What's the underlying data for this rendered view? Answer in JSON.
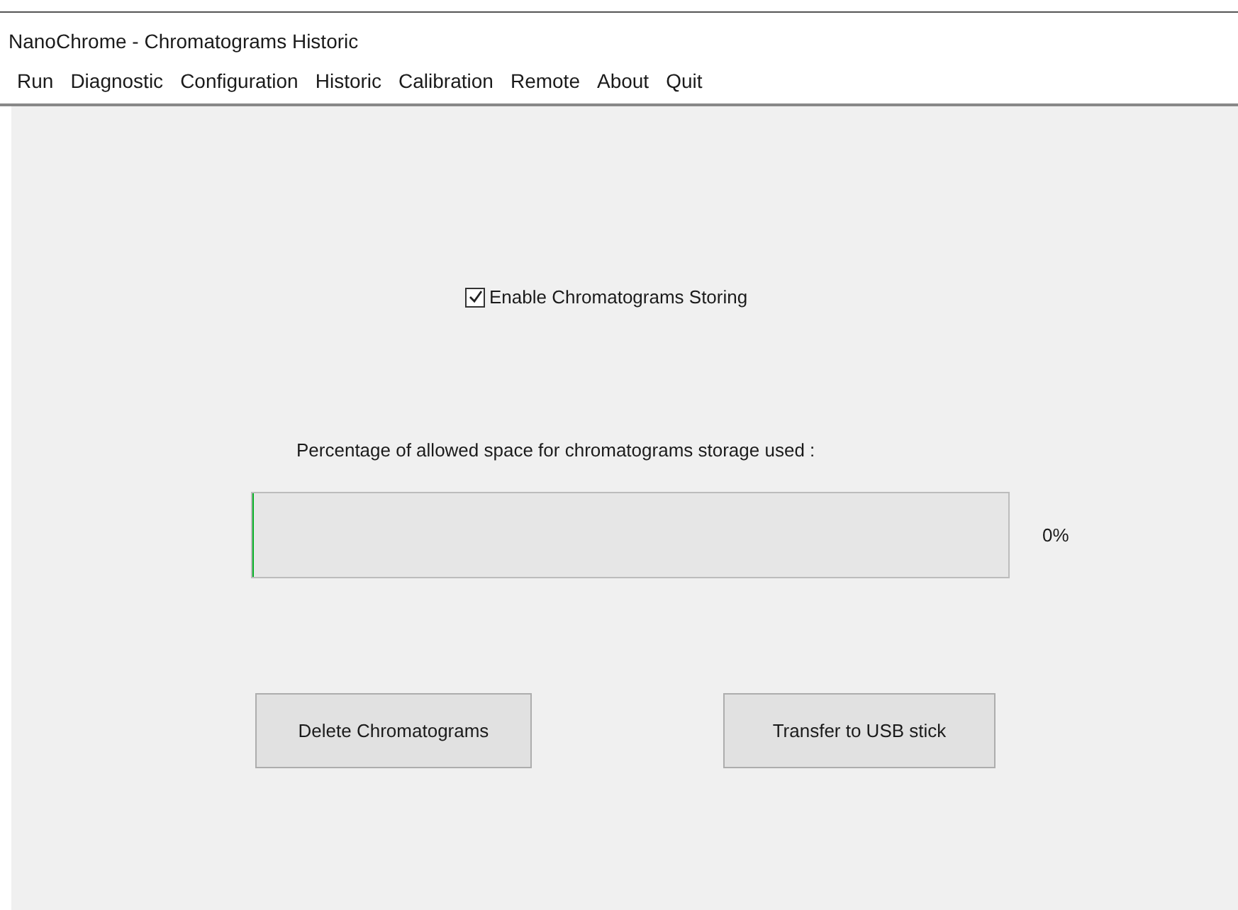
{
  "window": {
    "title": "NanoChrome - Chromatograms Historic"
  },
  "menu": [
    {
      "label": "Run"
    },
    {
      "label": "Diagnostic"
    },
    {
      "label": "Configuration"
    },
    {
      "label": "Historic"
    },
    {
      "label": "Calibration"
    },
    {
      "label": "Remote"
    },
    {
      "label": "About"
    },
    {
      "label": "Quit"
    }
  ],
  "storing": {
    "label": "Enable Chromatograms Storing",
    "checked": true
  },
  "storage": {
    "label": "Percentage of allowed space for chromatograms storage used :",
    "level": 0,
    "reading": "0%"
  },
  "buttons": [
    "Delete Chromatograms",
    "Transfer to USB stick"
  ]
}
